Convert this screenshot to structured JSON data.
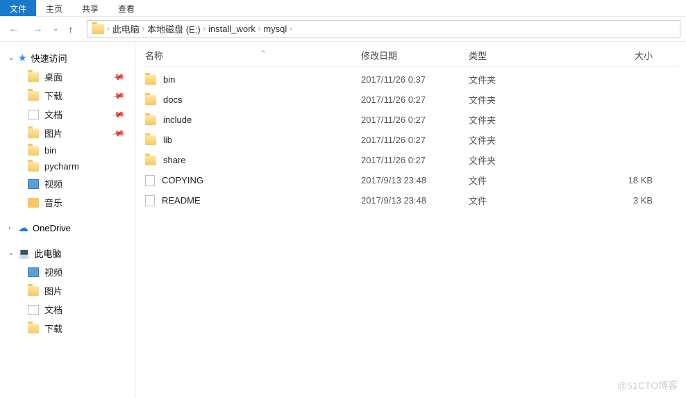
{
  "tabs": {
    "file": "文件",
    "home": "主页",
    "share": "共享",
    "view": "查看"
  },
  "breadcrumb": {
    "pc": "此电脑",
    "drive": "本地磁盘 (E:)",
    "dir1": "install_work",
    "dir2": "mysql"
  },
  "columns": {
    "name": "名称",
    "date": "修改日期",
    "type": "类型",
    "size": "大小"
  },
  "sidebar": {
    "quick": {
      "label": "快速访问",
      "items": [
        {
          "label": "桌面",
          "pinned": true,
          "icon": "folder"
        },
        {
          "label": "下载",
          "pinned": true,
          "icon": "folder"
        },
        {
          "label": "文档",
          "pinned": true,
          "icon": "doc"
        },
        {
          "label": "图片",
          "pinned": true,
          "icon": "folder"
        },
        {
          "label": "bin",
          "pinned": false,
          "icon": "folder"
        },
        {
          "label": "pycharm",
          "pinned": false,
          "icon": "folder"
        },
        {
          "label": "视频",
          "pinned": false,
          "icon": "media"
        },
        {
          "label": "音乐",
          "pinned": false,
          "icon": "music"
        }
      ]
    },
    "onedrive": {
      "label": "OneDrive"
    },
    "pc": {
      "label": "此电脑",
      "items": [
        {
          "label": "视频",
          "icon": "media"
        },
        {
          "label": "图片",
          "icon": "folder"
        },
        {
          "label": "文档",
          "icon": "doc"
        },
        {
          "label": "下载",
          "icon": "folder"
        }
      ]
    }
  },
  "files": [
    {
      "name": "bin",
      "date": "2017/11/26 0:37",
      "type": "文件夹",
      "size": "",
      "kind": "folder"
    },
    {
      "name": "docs",
      "date": "2017/11/26 0:27",
      "type": "文件夹",
      "size": "",
      "kind": "folder"
    },
    {
      "name": "include",
      "date": "2017/11/26 0:27",
      "type": "文件夹",
      "size": "",
      "kind": "folder"
    },
    {
      "name": "lib",
      "date": "2017/11/26 0:27",
      "type": "文件夹",
      "size": "",
      "kind": "folder"
    },
    {
      "name": "share",
      "date": "2017/11/26 0:27",
      "type": "文件夹",
      "size": "",
      "kind": "folder"
    },
    {
      "name": "COPYING",
      "date": "2017/9/13 23:48",
      "type": "文件",
      "size": "18 KB",
      "kind": "file"
    },
    {
      "name": "README",
      "date": "2017/9/13 23:48",
      "type": "文件",
      "size": "3 KB",
      "kind": "file"
    }
  ],
  "watermark": "@51CTO博客"
}
